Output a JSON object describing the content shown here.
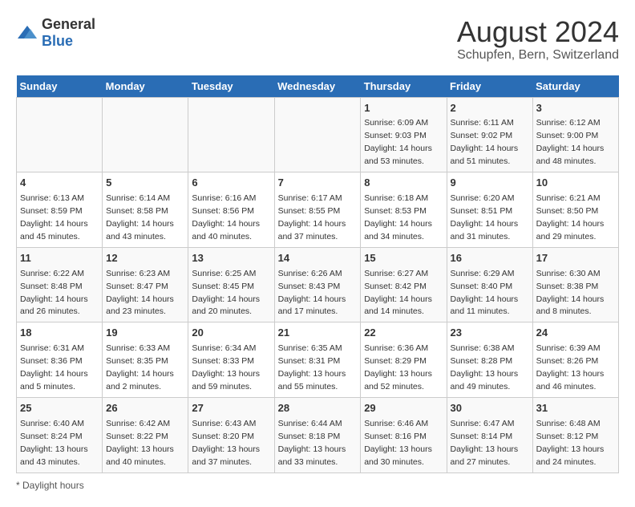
{
  "header": {
    "logo_general": "General",
    "logo_blue": "Blue",
    "main_title": "August 2024",
    "subtitle": "Schupfen, Bern, Switzerland"
  },
  "calendar": {
    "days_of_week": [
      "Sunday",
      "Monday",
      "Tuesday",
      "Wednesday",
      "Thursday",
      "Friday",
      "Saturday"
    ],
    "weeks": [
      [
        {
          "day": "",
          "info": ""
        },
        {
          "day": "",
          "info": ""
        },
        {
          "day": "",
          "info": ""
        },
        {
          "day": "",
          "info": ""
        },
        {
          "day": "1",
          "info": "Sunrise: 6:09 AM\nSunset: 9:03 PM\nDaylight: 14 hours and 53 minutes."
        },
        {
          "day": "2",
          "info": "Sunrise: 6:11 AM\nSunset: 9:02 PM\nDaylight: 14 hours and 51 minutes."
        },
        {
          "day": "3",
          "info": "Sunrise: 6:12 AM\nSunset: 9:00 PM\nDaylight: 14 hours and 48 minutes."
        }
      ],
      [
        {
          "day": "4",
          "info": "Sunrise: 6:13 AM\nSunset: 8:59 PM\nDaylight: 14 hours and 45 minutes."
        },
        {
          "day": "5",
          "info": "Sunrise: 6:14 AM\nSunset: 8:58 PM\nDaylight: 14 hours and 43 minutes."
        },
        {
          "day": "6",
          "info": "Sunrise: 6:16 AM\nSunset: 8:56 PM\nDaylight: 14 hours and 40 minutes."
        },
        {
          "day": "7",
          "info": "Sunrise: 6:17 AM\nSunset: 8:55 PM\nDaylight: 14 hours and 37 minutes."
        },
        {
          "day": "8",
          "info": "Sunrise: 6:18 AM\nSunset: 8:53 PM\nDaylight: 14 hours and 34 minutes."
        },
        {
          "day": "9",
          "info": "Sunrise: 6:20 AM\nSunset: 8:51 PM\nDaylight: 14 hours and 31 minutes."
        },
        {
          "day": "10",
          "info": "Sunrise: 6:21 AM\nSunset: 8:50 PM\nDaylight: 14 hours and 29 minutes."
        }
      ],
      [
        {
          "day": "11",
          "info": "Sunrise: 6:22 AM\nSunset: 8:48 PM\nDaylight: 14 hours and 26 minutes."
        },
        {
          "day": "12",
          "info": "Sunrise: 6:23 AM\nSunset: 8:47 PM\nDaylight: 14 hours and 23 minutes."
        },
        {
          "day": "13",
          "info": "Sunrise: 6:25 AM\nSunset: 8:45 PM\nDaylight: 14 hours and 20 minutes."
        },
        {
          "day": "14",
          "info": "Sunrise: 6:26 AM\nSunset: 8:43 PM\nDaylight: 14 hours and 17 minutes."
        },
        {
          "day": "15",
          "info": "Sunrise: 6:27 AM\nSunset: 8:42 PM\nDaylight: 14 hours and 14 minutes."
        },
        {
          "day": "16",
          "info": "Sunrise: 6:29 AM\nSunset: 8:40 PM\nDaylight: 14 hours and 11 minutes."
        },
        {
          "day": "17",
          "info": "Sunrise: 6:30 AM\nSunset: 8:38 PM\nDaylight: 14 hours and 8 minutes."
        }
      ],
      [
        {
          "day": "18",
          "info": "Sunrise: 6:31 AM\nSunset: 8:36 PM\nDaylight: 14 hours and 5 minutes."
        },
        {
          "day": "19",
          "info": "Sunrise: 6:33 AM\nSunset: 8:35 PM\nDaylight: 14 hours and 2 minutes."
        },
        {
          "day": "20",
          "info": "Sunrise: 6:34 AM\nSunset: 8:33 PM\nDaylight: 13 hours and 59 minutes."
        },
        {
          "day": "21",
          "info": "Sunrise: 6:35 AM\nSunset: 8:31 PM\nDaylight: 13 hours and 55 minutes."
        },
        {
          "day": "22",
          "info": "Sunrise: 6:36 AM\nSunset: 8:29 PM\nDaylight: 13 hours and 52 minutes."
        },
        {
          "day": "23",
          "info": "Sunrise: 6:38 AM\nSunset: 8:28 PM\nDaylight: 13 hours and 49 minutes."
        },
        {
          "day": "24",
          "info": "Sunrise: 6:39 AM\nSunset: 8:26 PM\nDaylight: 13 hours and 46 minutes."
        }
      ],
      [
        {
          "day": "25",
          "info": "Sunrise: 6:40 AM\nSunset: 8:24 PM\nDaylight: 13 hours and 43 minutes."
        },
        {
          "day": "26",
          "info": "Sunrise: 6:42 AM\nSunset: 8:22 PM\nDaylight: 13 hours and 40 minutes."
        },
        {
          "day": "27",
          "info": "Sunrise: 6:43 AM\nSunset: 8:20 PM\nDaylight: 13 hours and 37 minutes."
        },
        {
          "day": "28",
          "info": "Sunrise: 6:44 AM\nSunset: 8:18 PM\nDaylight: 13 hours and 33 minutes."
        },
        {
          "day": "29",
          "info": "Sunrise: 6:46 AM\nSunset: 8:16 PM\nDaylight: 13 hours and 30 minutes."
        },
        {
          "day": "30",
          "info": "Sunrise: 6:47 AM\nSunset: 8:14 PM\nDaylight: 13 hours and 27 minutes."
        },
        {
          "day": "31",
          "info": "Sunrise: 6:48 AM\nSunset: 8:12 PM\nDaylight: 13 hours and 24 minutes."
        }
      ]
    ]
  },
  "footer": {
    "note": "Daylight hours"
  }
}
